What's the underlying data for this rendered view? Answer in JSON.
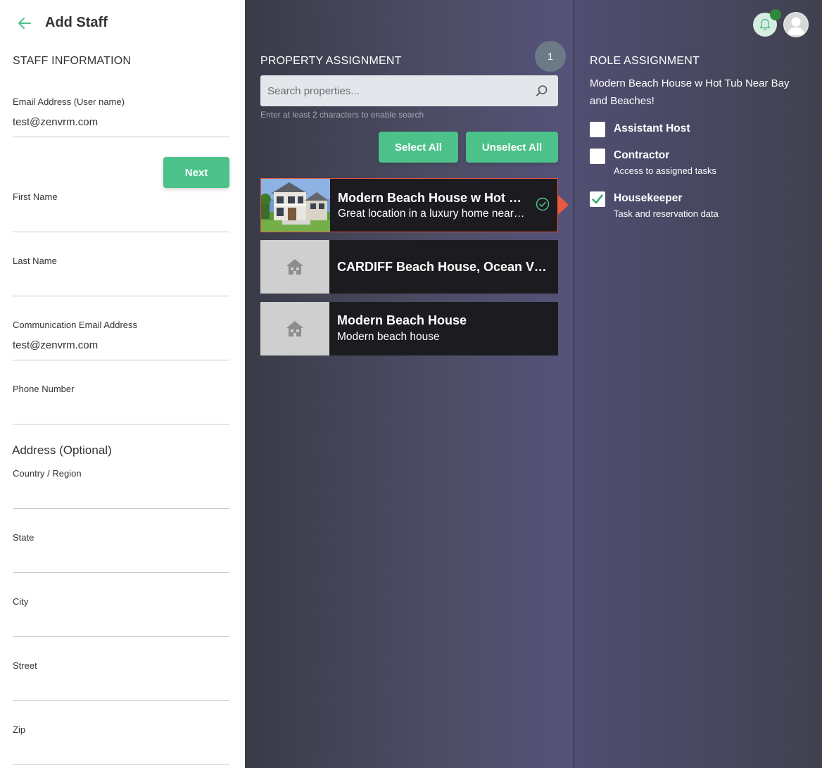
{
  "header": {
    "title": "Add Staff",
    "back_icon": "arrow-left-icon",
    "accent": "#4cc28a"
  },
  "staff_info": {
    "section_title": "STAFF INFORMATION",
    "fields": [
      {
        "label": "Email Address (User name)",
        "value": "test@zenvrm.com"
      },
      {
        "label": "First Name",
        "value": ""
      },
      {
        "label": "Last Name",
        "value": ""
      },
      {
        "label": "Communication Email Address",
        "value": "test@zenvrm.com"
      },
      {
        "label": "Phone Number",
        "value": ""
      }
    ],
    "next_label": "Next",
    "address_title": "Address (Optional)",
    "address_fields": [
      {
        "label": "Country / Region",
        "value": ""
      },
      {
        "label": "State",
        "value": ""
      },
      {
        "label": "City",
        "value": ""
      },
      {
        "label": "Street",
        "value": ""
      },
      {
        "label": "Zip",
        "value": ""
      }
    ]
  },
  "property_assignment": {
    "title": "PROPERTY ASSIGNMENT",
    "selected_count": "1",
    "search_placeholder": "Search properties...",
    "search_hint": "Enter at least 2 characters to enable search",
    "select_all_label": "Select All",
    "unselect_all_label": "Unselect All",
    "properties": [
      {
        "title": "Modern Beach House w Hot Tub Near Bay and Beaches!",
        "subtitle": "Great location in a luxury home near the bay and beaches",
        "selected": true,
        "has_photo": true
      },
      {
        "title": "CARDIFF Beach House, Ocean View",
        "subtitle": "",
        "selected": false,
        "has_photo": false
      },
      {
        "title": "Modern Beach House",
        "subtitle": "Modern beach house",
        "selected": false,
        "has_photo": false
      }
    ],
    "selected_color": "#e8593f"
  },
  "role_assignment": {
    "title": "ROLE ASSIGNMENT",
    "property_name": "Modern Beach House w Hot Tub Near Bay and Beaches!",
    "roles": [
      {
        "name": "Assistant Host",
        "description": "",
        "checked": false
      },
      {
        "name": "Contractor",
        "description": "Access to assigned tasks",
        "checked": false
      },
      {
        "name": "Housekeeper",
        "description": "Task and reservation data",
        "checked": true
      }
    ]
  },
  "top_icons": {
    "notifications": "bell-icon",
    "profile": "avatar-icon",
    "status_color": "#2e8b3d"
  }
}
